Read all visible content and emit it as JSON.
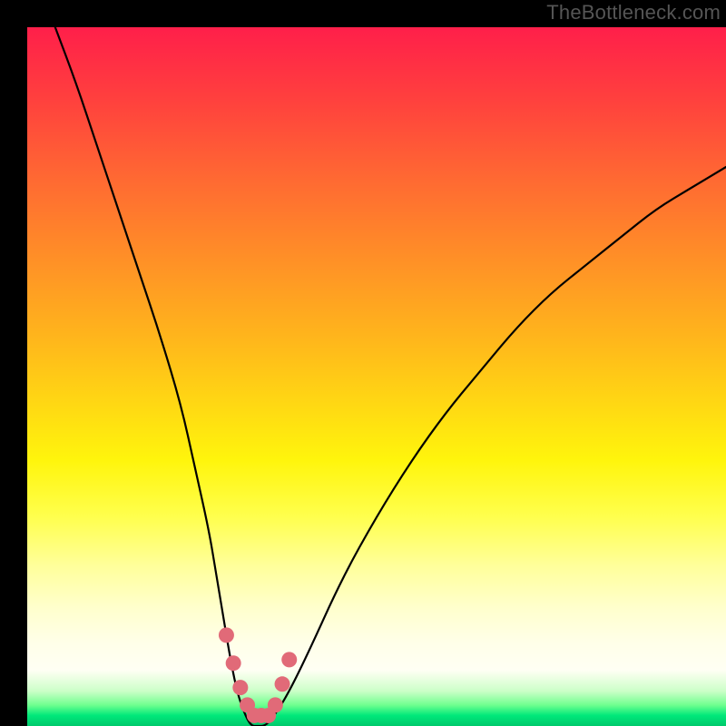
{
  "watermark": "TheBottleneck.com",
  "chart_data": {
    "type": "line",
    "title": "",
    "xlabel": "",
    "ylabel": "",
    "xlim": [
      0,
      100
    ],
    "ylim": [
      0,
      100
    ],
    "grid": false,
    "legend": false,
    "series": [
      {
        "name": "bottleneck-curve",
        "x": [
          4,
          7,
          10,
          13,
          16,
          19,
          22,
          24,
          26,
          27,
          28,
          29,
          30,
          31,
          32,
          33,
          34,
          35,
          37,
          40,
          45,
          50,
          55,
          60,
          65,
          70,
          75,
          80,
          85,
          90,
          95,
          100
        ],
        "y": [
          100,
          92,
          83,
          74,
          65,
          56,
          46,
          37,
          28,
          22,
          16,
          10,
          5,
          2,
          0,
          0,
          0,
          1,
          4,
          10,
          21,
          30,
          38,
          45,
          51,
          57,
          62,
          66,
          70,
          74,
          77,
          80
        ]
      }
    ],
    "annotations": [
      {
        "name": "valley-marker",
        "color": "#e16a78",
        "x": [
          28.5,
          29.5,
          30.5,
          31.5,
          32.5,
          33.5,
          34.5,
          35.5,
          36.5,
          37.5
        ],
        "y": [
          13,
          9,
          5.5,
          3,
          1.5,
          1.5,
          1.5,
          3,
          6,
          9.5
        ]
      }
    ]
  }
}
